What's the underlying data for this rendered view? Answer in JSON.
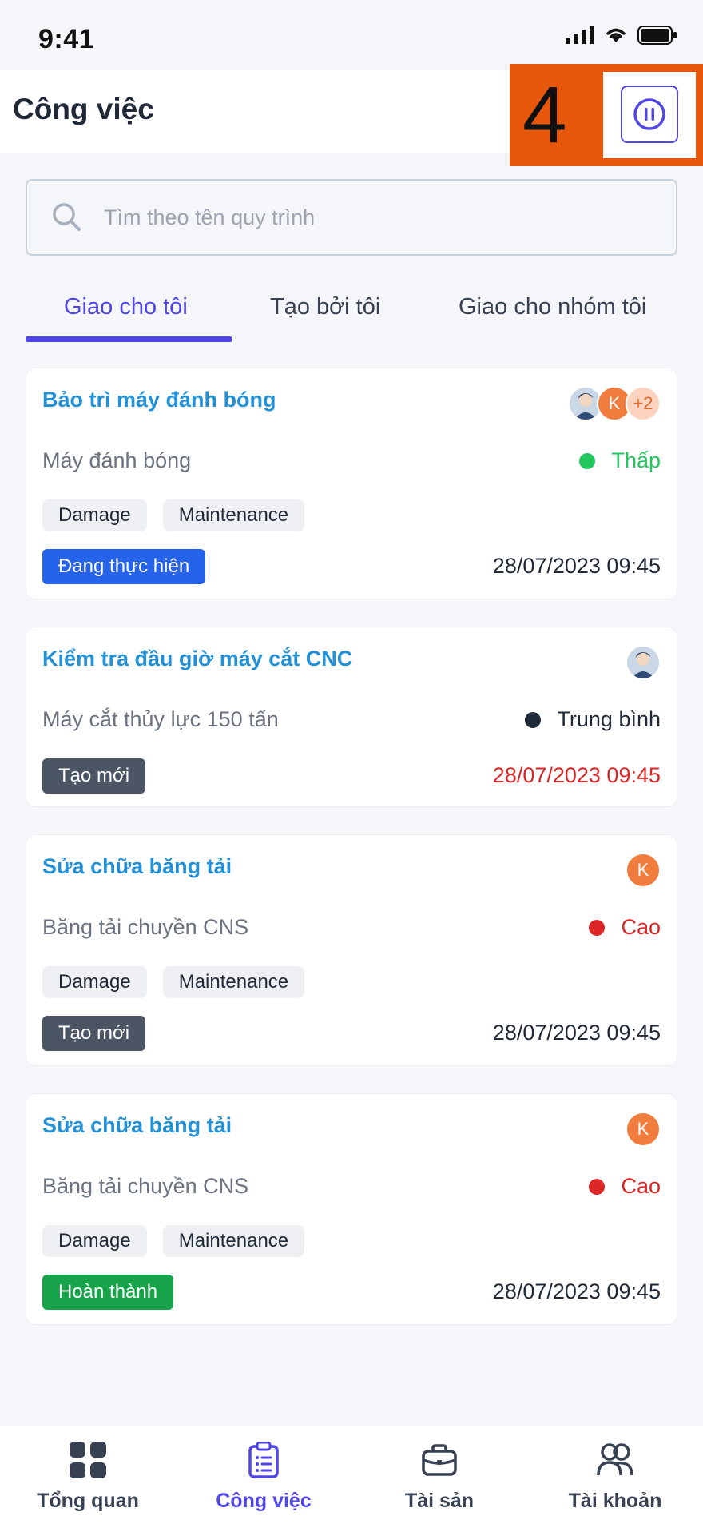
{
  "status_bar": {
    "time": "9:41"
  },
  "header": {
    "title": "Công việc",
    "overlay_number": "4"
  },
  "search": {
    "placeholder": "Tìm theo tên quy trình"
  },
  "tabs": [
    {
      "label": "Giao cho tôi",
      "active": true
    },
    {
      "label": "Tạo bởi tôi",
      "active": false
    },
    {
      "label": "Giao cho nhóm tôi",
      "active": false
    }
  ],
  "cards": [
    {
      "title": "Bảo trì máy đánh bóng",
      "asset": "Máy đánh bóng",
      "priority": "Thấp",
      "priority_color": "#22C55E",
      "tags": [
        "Damage",
        "Maintenance"
      ],
      "status": "Đang thực hiện",
      "status_color": "#2563EB",
      "date": "28/07/2023 09:45",
      "date_color": "#1F2937",
      "avatars": {
        "k": "K",
        "more": "+2"
      }
    },
    {
      "title": "Kiểm tra đầu giờ máy cắt CNC",
      "asset": "Máy cắt thủy lực 150 tấn",
      "priority": "Trung bình",
      "priority_color": "#1F2937",
      "status": "Tạo mới",
      "status_color": "#4B5563",
      "date": "28/07/2023 09:45",
      "date_color": "#DC2626"
    },
    {
      "title": "Sửa chữa băng tải",
      "asset": "Băng tải chuyền CNS",
      "priority": "Cao",
      "priority_color": "#DC2626",
      "tags": [
        "Damage",
        "Maintenance"
      ],
      "status": "Tạo mới",
      "status_color": "#4B5563",
      "date": "28/07/2023 09:45",
      "date_color": "#1F2937",
      "avatars": {
        "k": "K"
      }
    },
    {
      "title": "Sửa chữa băng tải",
      "asset": "Băng tải chuyền CNS",
      "priority": "Cao",
      "priority_color": "#DC2626",
      "tags": [
        "Damage",
        "Maintenance"
      ],
      "status": "Hoàn thành",
      "status_color": "#16A34A",
      "date": "28/07/2023 09:45",
      "date_color": "#1F2937",
      "avatars": {
        "k": "K"
      }
    }
  ],
  "bottom_nav": [
    {
      "label": "Tổng quan",
      "icon": "grid-icon",
      "active": false
    },
    {
      "label": "Công việc",
      "icon": "clipboard-icon",
      "active": true
    },
    {
      "label": "Tài sản",
      "icon": "briefcase-icon",
      "active": false
    },
    {
      "label": "Tài khoản",
      "icon": "users-icon",
      "active": false
    }
  ],
  "colors": {
    "accent": "#4F46E5",
    "title_blue": "#2491D6",
    "overlay": "#E8580C"
  }
}
